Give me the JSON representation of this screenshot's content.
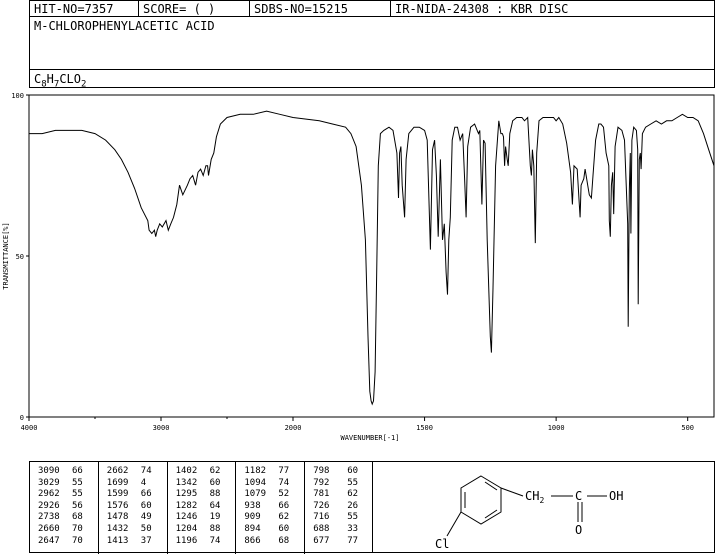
{
  "header": {
    "hit_no": "HIT-NO=7357",
    "score": "SCORE=  (   )",
    "sdbs_no": "SDBS-NO=15215",
    "ir_nida": "IR-NIDA-24308 : KBR DISC"
  },
  "compound_name": "M-CHLOROPHENYLACETIC ACID",
  "formula": {
    "prefix": "C",
    "c_sub": "8",
    "h": "H",
    "h_sub": "7",
    "rest": "CLO",
    "o_sub": "2"
  },
  "chart_data": {
    "type": "line",
    "xlabel": "WAVENUMBER[-1]",
    "ylabel": "TRANSMITTANCE[%]",
    "xlim": [
      4000,
      400
    ],
    "ylim": [
      0,
      100
    ],
    "x_ticks": [
      "4000",
      "3000",
      "2000",
      "1500",
      "1000",
      "500"
    ],
    "x_tick_values": [
      4000,
      3000,
      2000,
      1500,
      1000,
      500
    ],
    "y_ticks": [
      "100",
      "50",
      "0"
    ],
    "y_tick_values": [
      100,
      50,
      0
    ],
    "x_minor": [
      3500,
      2500
    ],
    "spectrum": [
      [
        4000,
        88
      ],
      [
        3900,
        88
      ],
      [
        3800,
        89
      ],
      [
        3700,
        89
      ],
      [
        3600,
        89
      ],
      [
        3500,
        88
      ],
      [
        3420,
        86
      ],
      [
        3350,
        83
      ],
      [
        3300,
        80
      ],
      [
        3250,
        76
      ],
      [
        3200,
        71
      ],
      [
        3150,
        65
      ],
      [
        3100,
        61
      ],
      [
        3090,
        58
      ],
      [
        3070,
        57
      ],
      [
        3050,
        58
      ],
      [
        3040,
        56
      ],
      [
        3029,
        58
      ],
      [
        3010,
        60
      ],
      [
        2990,
        59
      ],
      [
        2962,
        61
      ],
      [
        2945,
        58
      ],
      [
        2926,
        60
      ],
      [
        2905,
        62
      ],
      [
        2880,
        66
      ],
      [
        2860,
        72
      ],
      [
        2835,
        69
      ],
      [
        2800,
        72
      ],
      [
        2780,
        74
      ],
      [
        2760,
        75
      ],
      [
        2738,
        72
      ],
      [
        2720,
        76
      ],
      [
        2700,
        77
      ],
      [
        2680,
        75
      ],
      [
        2660,
        78
      ],
      [
        2647,
        78
      ],
      [
        2640,
        75
      ],
      [
        2620,
        80
      ],
      [
        2600,
        82
      ],
      [
        2580,
        87
      ],
      [
        2550,
        91
      ],
      [
        2500,
        93
      ],
      [
        2400,
        94
      ],
      [
        2300,
        94
      ],
      [
        2200,
        95
      ],
      [
        2100,
        94
      ],
      [
        2000,
        93
      ],
      [
        1900,
        92
      ],
      [
        1850,
        91
      ],
      [
        1800,
        90
      ],
      [
        1780,
        88
      ],
      [
        1760,
        84
      ],
      [
        1740,
        72
      ],
      [
        1725,
        55
      ],
      [
        1715,
        25
      ],
      [
        1708,
        8
      ],
      [
        1703,
        5
      ],
      [
        1699,
        4
      ],
      [
        1694,
        5
      ],
      [
        1688,
        14
      ],
      [
        1682,
        45
      ],
      [
        1676,
        78
      ],
      [
        1668,
        88
      ],
      [
        1655,
        89
      ],
      [
        1635,
        90
      ],
      [
        1620,
        89
      ],
      [
        1605,
        82
      ],
      [
        1599,
        68
      ],
      [
        1595,
        82
      ],
      [
        1590,
        84
      ],
      [
        1585,
        72
      ],
      [
        1576,
        62
      ],
      [
        1570,
        80
      ],
      [
        1560,
        88
      ],
      [
        1540,
        90
      ],
      [
        1520,
        90
      ],
      [
        1500,
        89
      ],
      [
        1490,
        86
      ],
      [
        1478,
        52
      ],
      [
        1470,
        83
      ],
      [
        1462,
        86
      ],
      [
        1455,
        75
      ],
      [
        1448,
        56
      ],
      [
        1440,
        80
      ],
      [
        1432,
        55
      ],
      [
        1425,
        60
      ],
      [
        1418,
        45
      ],
      [
        1413,
        38
      ],
      [
        1408,
        55
      ],
      [
        1402,
        62
      ],
      [
        1395,
        86
      ],
      [
        1385,
        90
      ],
      [
        1375,
        90
      ],
      [
        1365,
        86
      ],
      [
        1355,
        88
      ],
      [
        1348,
        74
      ],
      [
        1342,
        62
      ],
      [
        1336,
        84
      ],
      [
        1325,
        90
      ],
      [
        1310,
        91
      ],
      [
        1300,
        89
      ],
      [
        1295,
        88
      ],
      [
        1290,
        89
      ],
      [
        1282,
        66
      ],
      [
        1276,
        86
      ],
      [
        1270,
        85
      ],
      [
        1262,
        55
      ],
      [
        1250,
        25
      ],
      [
        1246,
        20
      ],
      [
        1240,
        40
      ],
      [
        1230,
        78
      ],
      [
        1218,
        92
      ],
      [
        1210,
        88
      ],
      [
        1204,
        88
      ],
      [
        1200,
        87
      ],
      [
        1196,
        78
      ],
      [
        1192,
        84
      ],
      [
        1186,
        80
      ],
      [
        1182,
        78
      ],
      [
        1176,
        88
      ],
      [
        1165,
        92
      ],
      [
        1150,
        93
      ],
      [
        1130,
        93
      ],
      [
        1120,
        92
      ],
      [
        1108,
        93
      ],
      [
        1098,
        78
      ],
      [
        1094,
        75
      ],
      [
        1090,
        83
      ],
      [
        1085,
        78
      ],
      [
        1079,
        54
      ],
      [
        1074,
        82
      ],
      [
        1065,
        92
      ],
      [
        1050,
        93
      ],
      [
        1030,
        93
      ],
      [
        1010,
        93
      ],
      [
        1000,
        92
      ],
      [
        990,
        93
      ],
      [
        975,
        91
      ],
      [
        960,
        85
      ],
      [
        945,
        76
      ],
      [
        938,
        66
      ],
      [
        932,
        78
      ],
      [
        920,
        77
      ],
      [
        912,
        66
      ],
      [
        909,
        62
      ],
      [
        905,
        72
      ],
      [
        895,
        74
      ],
      [
        890,
        77
      ],
      [
        880,
        72
      ],
      [
        874,
        69
      ],
      [
        866,
        68
      ],
      [
        860,
        75
      ],
      [
        850,
        86
      ],
      [
        838,
        91
      ],
      [
        830,
        91
      ],
      [
        820,
        90
      ],
      [
        810,
        82
      ],
      [
        800,
        78
      ],
      [
        798,
        61
      ],
      [
        794,
        56
      ],
      [
        790,
        72
      ],
      [
        785,
        76
      ],
      [
        781,
        63
      ],
      [
        776,
        84
      ],
      [
        765,
        90
      ],
      [
        750,
        89
      ],
      [
        740,
        86
      ],
      [
        728,
        60
      ],
      [
        726,
        28
      ],
      [
        722,
        70
      ],
      [
        718,
        82
      ],
      [
        716,
        57
      ],
      [
        712,
        86
      ],
      [
        705,
        90
      ],
      [
        695,
        89
      ],
      [
        690,
        83
      ],
      [
        688,
        35
      ],
      [
        684,
        80
      ],
      [
        680,
        82
      ],
      [
        677,
        77
      ],
      [
        672,
        88
      ],
      [
        660,
        90
      ],
      [
        640,
        91
      ],
      [
        620,
        92
      ],
      [
        600,
        91
      ],
      [
        580,
        92
      ],
      [
        560,
        92
      ],
      [
        540,
        93
      ],
      [
        520,
        94
      ],
      [
        500,
        93
      ],
      [
        480,
        93
      ],
      [
        460,
        92
      ],
      [
        440,
        88
      ],
      [
        420,
        83
      ],
      [
        400,
        78
      ]
    ],
    "peak_table": [
      [
        3090,
        66
      ],
      [
        3029,
        55
      ],
      [
        2962,
        55
      ],
      [
        2926,
        56
      ],
      [
        2738,
        68
      ],
      [
        2660,
        70
      ],
      [
        2647,
        70
      ],
      [
        2662,
        74
      ],
      [
        1699,
        4
      ],
      [
        1599,
        66
      ],
      [
        1576,
        60
      ],
      [
        1478,
        49
      ],
      [
        1432,
        50
      ],
      [
        1413,
        37
      ],
      [
        1402,
        62
      ],
      [
        1342,
        60
      ],
      [
        1295,
        88
      ],
      [
        1282,
        64
      ],
      [
        1246,
        19
      ],
      [
        1204,
        88
      ],
      [
        1196,
        74
      ],
      [
        1182,
        77
      ],
      [
        1094,
        74
      ],
      [
        1079,
        52
      ],
      [
        938,
        66
      ],
      [
        909,
        62
      ],
      [
        894,
        60
      ],
      [
        866,
        68
      ],
      [
        798,
        60
      ],
      [
        792,
        55
      ],
      [
        781,
        62
      ],
      [
        726,
        26
      ],
      [
        716,
        55
      ],
      [
        688,
        33
      ],
      [
        677,
        77
      ]
    ]
  },
  "peaks_display": [
    [
      [
        "3090",
        "66"
      ],
      [
        "3029",
        "55"
      ],
      [
        "2962",
        "55"
      ],
      [
        "2926",
        "56"
      ],
      [
        "2738",
        "68"
      ],
      [
        "2660",
        "70"
      ],
      [
        "2647",
        "70"
      ]
    ],
    [
      [
        "2662",
        "74"
      ],
      [
        "1699",
        "4"
      ],
      [
        "1599",
        "66"
      ],
      [
        "1576",
        "60"
      ],
      [
        "1478",
        "49"
      ],
      [
        "1432",
        "50"
      ],
      [
        "1413",
        "37"
      ]
    ],
    [
      [
        "1402",
        "62"
      ],
      [
        "1342",
        "60"
      ],
      [
        "1295",
        "88"
      ],
      [
        "1282",
        "64"
      ],
      [
        "1246",
        "19"
      ],
      [
        "1204",
        "88"
      ],
      [
        "1196",
        "74"
      ]
    ],
    [
      [
        "1182",
        "77"
      ],
      [
        "1094",
        "74"
      ],
      [
        "1079",
        "52"
      ],
      [
        "938",
        "66"
      ],
      [
        "909",
        "62"
      ],
      [
        "894",
        "60"
      ],
      [
        "866",
        "68"
      ]
    ],
    [
      [
        "798",
        "60"
      ],
      [
        "792",
        "55"
      ],
      [
        "781",
        "62"
      ],
      [
        "726",
        "26"
      ],
      [
        "716",
        "55"
      ],
      [
        "688",
        "33"
      ],
      [
        "677",
        "77"
      ]
    ]
  ],
  "structure": {
    "ch2": "CH",
    "ch2_sub": "2",
    "c": "C",
    "oh": "OH",
    "o": "O",
    "cl": "Cl"
  }
}
